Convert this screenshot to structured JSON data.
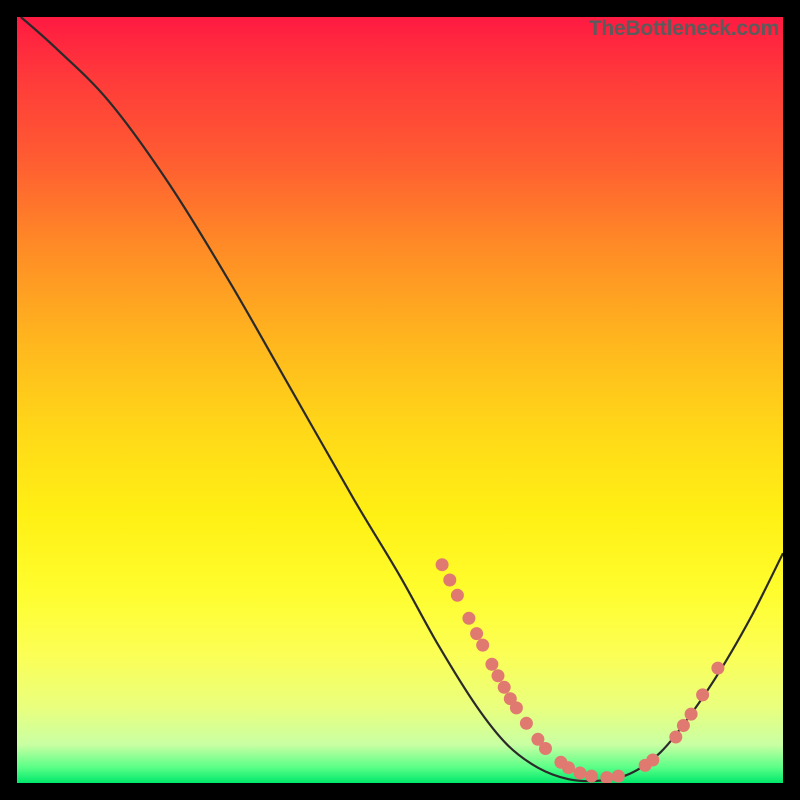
{
  "watermark": "TheBottleneck.com",
  "colors": {
    "background": "#000000",
    "curve_stroke": "#2a2a2a",
    "dot_fill": "#e07a70",
    "gradient_top": "#ff1a42",
    "gradient_bottom": "#00e86b"
  },
  "chart_data": {
    "type": "line",
    "title": "",
    "xlabel": "",
    "ylabel": "",
    "xlim": [
      0,
      100
    ],
    "ylim": [
      0,
      100
    ],
    "curve": [
      {
        "x": 0.5,
        "y": 100
      },
      {
        "x": 5,
        "y": 96
      },
      {
        "x": 12,
        "y": 89
      },
      {
        "x": 20,
        "y": 78
      },
      {
        "x": 28,
        "y": 65
      },
      {
        "x": 36,
        "y": 51
      },
      {
        "x": 44,
        "y": 37
      },
      {
        "x": 50,
        "y": 27
      },
      {
        "x": 55,
        "y": 18
      },
      {
        "x": 60,
        "y": 10
      },
      {
        "x": 64,
        "y": 5
      },
      {
        "x": 68,
        "y": 2
      },
      {
        "x": 72,
        "y": 0.5
      },
      {
        "x": 76,
        "y": 0.3
      },
      {
        "x": 80,
        "y": 1.2
      },
      {
        "x": 84,
        "y": 4
      },
      {
        "x": 88,
        "y": 9
      },
      {
        "x": 92,
        "y": 15
      },
      {
        "x": 96,
        "y": 22
      },
      {
        "x": 100,
        "y": 30
      }
    ],
    "dots": [
      {
        "x": 55.5,
        "y": 28.5
      },
      {
        "x": 56.5,
        "y": 26.5
      },
      {
        "x": 57.5,
        "y": 24.5
      },
      {
        "x": 59,
        "y": 21.5
      },
      {
        "x": 60,
        "y": 19.5
      },
      {
        "x": 60.8,
        "y": 18
      },
      {
        "x": 62,
        "y": 15.5
      },
      {
        "x": 62.8,
        "y": 14
      },
      {
        "x": 63.6,
        "y": 12.5
      },
      {
        "x": 64.4,
        "y": 11
      },
      {
        "x": 65.2,
        "y": 9.8
      },
      {
        "x": 66.5,
        "y": 7.8
      },
      {
        "x": 68,
        "y": 5.7
      },
      {
        "x": 69,
        "y": 4.5
      },
      {
        "x": 71,
        "y": 2.7
      },
      {
        "x": 72,
        "y": 2
      },
      {
        "x": 73.5,
        "y": 1.3
      },
      {
        "x": 75,
        "y": 0.9
      },
      {
        "x": 77,
        "y": 0.7
      },
      {
        "x": 78.5,
        "y": 0.9
      },
      {
        "x": 82,
        "y": 2.3
      },
      {
        "x": 83,
        "y": 3
      },
      {
        "x": 86,
        "y": 6
      },
      {
        "x": 87,
        "y": 7.5
      },
      {
        "x": 88,
        "y": 9
      },
      {
        "x": 89.5,
        "y": 11.5
      },
      {
        "x": 91.5,
        "y": 15
      }
    ]
  }
}
